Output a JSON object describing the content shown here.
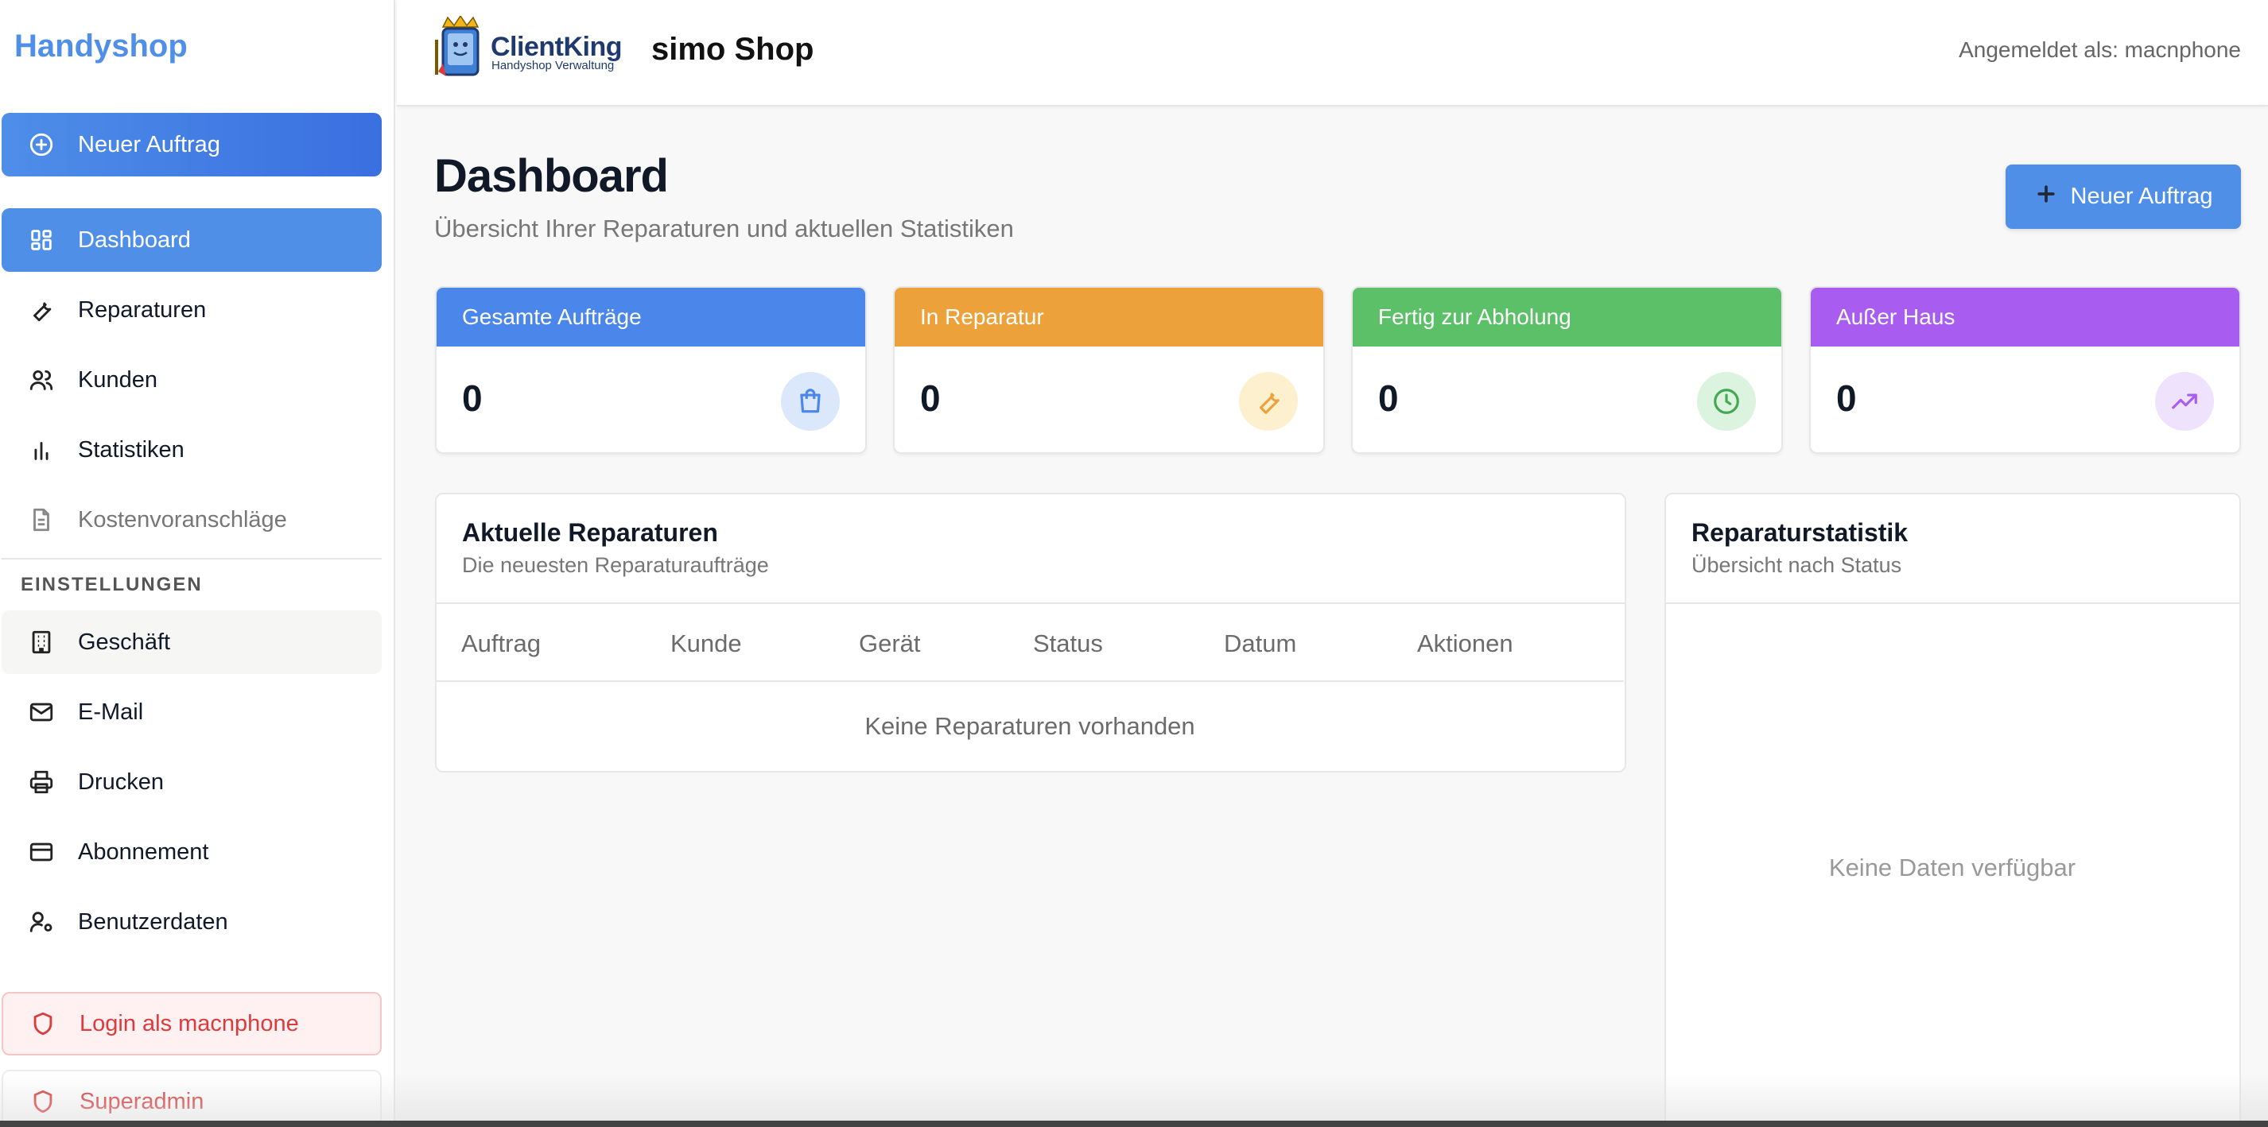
{
  "sidebar": {
    "brand": "Handyshop",
    "primary_action": "Neuer Auftrag",
    "items": [
      {
        "label": "Dashboard",
        "icon": "dashboard-icon"
      },
      {
        "label": "Reparaturen",
        "icon": "wrench-icon"
      },
      {
        "label": "Kunden",
        "icon": "users-icon"
      },
      {
        "label": "Statistiken",
        "icon": "bar-chart-icon"
      },
      {
        "label": "Kostenvoranschläge",
        "icon": "document-icon"
      }
    ],
    "settings_label": "EINSTELLUNGEN",
    "settings_items": [
      {
        "label": "Geschäft",
        "icon": "building-icon"
      },
      {
        "label": "E-Mail",
        "icon": "mail-icon"
      },
      {
        "label": "Drucken",
        "icon": "printer-icon"
      },
      {
        "label": "Abonnement",
        "icon": "credit-card-icon"
      },
      {
        "label": "Benutzerdaten",
        "icon": "user-cog-icon"
      }
    ],
    "login_as": "Login als macnphone",
    "superadmin": "Superadmin"
  },
  "header": {
    "logo_title": "ClientKing",
    "logo_subtitle": "Handyshop Verwaltung",
    "shop_name": "simo Shop",
    "logged_in": "Angemeldet als: macnphone"
  },
  "main": {
    "title": "Dashboard",
    "subtitle": "Übersicht Ihrer Reparaturen und aktuellen Statistiken",
    "new_order_button": "Neuer Auftrag",
    "stats": [
      {
        "label": "Gesamte Aufträge",
        "value": "0",
        "color": "#4b86ea",
        "icon": "shopping-bag-icon"
      },
      {
        "label": "In Reparatur",
        "value": "0",
        "color": "#eca13a",
        "icon": "wrench-icon"
      },
      {
        "label": "Fertig zur Abholung",
        "value": "0",
        "color": "#5cc068",
        "icon": "clock-icon"
      },
      {
        "label": "Außer Haus",
        "value": "0",
        "color": "#a85df0",
        "icon": "trending-up-icon"
      }
    ],
    "recent": {
      "title": "Aktuelle Reparaturen",
      "subtitle": "Die neuesten Reparaturaufträge",
      "columns": [
        "Auftrag",
        "Kunde",
        "Gerät",
        "Status",
        "Datum",
        "Aktionen"
      ],
      "empty": "Keine Reparaturen vorhanden"
    },
    "stats_panel": {
      "title": "Reparaturstatistik",
      "subtitle": "Übersicht nach Status",
      "empty": "Keine Daten verfügbar"
    }
  }
}
